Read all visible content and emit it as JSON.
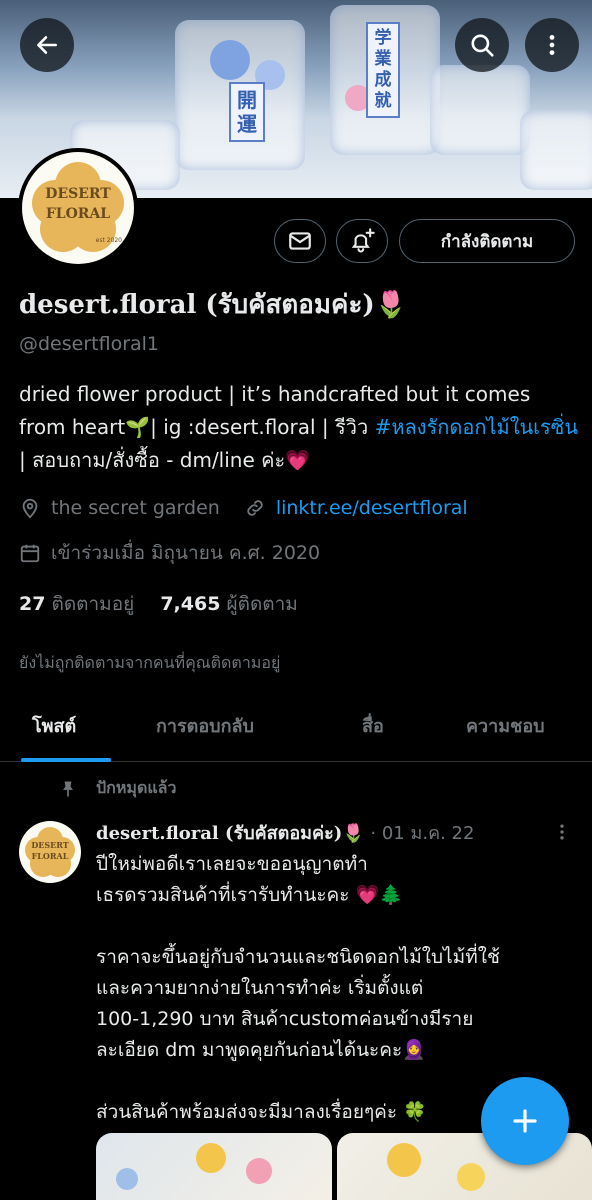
{
  "profile": {
    "name": "desert.floral (รับคัสตอมค่ะ)🌷",
    "handle": "@desertfloral1",
    "bio_part1": "dried flower product | it’s handcrafted but it comes from heart🌱| ig :desert.floral | รีวิว ",
    "bio_hashtag": "#หลงรักดอกไม้ในเรซิ่น",
    "bio_part2": " | สอบถาม/สั่งซื้อ - dm/line ค่ะ💗",
    "location": "the secret garden",
    "website": "linktr.ee/desertfloral",
    "joined": "เข้าร่วมเมื่อ มิถุนายน ค.ศ. 2020",
    "following_count": "27",
    "following_label": "ติดตามอยู่",
    "followers_count": "7,465",
    "followers_label": "ผู้ติดตาม",
    "not_followed_note": "ยังไม่ถูกติดตามจากคนที่คุณติดตามอยู่",
    "avatar_text_line1": "DESERT",
    "avatar_text_line2": "FLORAL",
    "avatar_text_small": "est 2020"
  },
  "banner": {
    "charm1": "開運",
    "charm2": "学業成就"
  },
  "actions": {
    "follow_label": "กำลังติดตาม",
    "back_icon": "arrow-left-icon",
    "search_icon": "search-icon",
    "more_icon": "more-vertical-icon",
    "message_icon": "envelope-icon",
    "notify_icon": "bell-plus-icon"
  },
  "tabs": [
    {
      "label": "โพสต์",
      "active": true
    },
    {
      "label": "การตอบกลับ",
      "active": false
    },
    {
      "label": "สื่อ",
      "active": false
    },
    {
      "label": "ความชอบ",
      "active": false
    }
  ],
  "post": {
    "pinned_label": "ปักหมุดแล้ว",
    "author": "desert.floral (รับคัสตอมค่ะ)🌷",
    "date": " · 01 ม.ค. 22",
    "body": "ปีใหม่พอดีเราเลยจะขออนุญาตทำ\nเธรดรวมสินค้าที่เรารับทำนะคะ 💗🌲\n\nราคาจะขึ้นอยู่กับจำนวนและชนิดดอกไม้ใบไม้ที่ใช้\nและความยากง่ายในการทำค่ะ เริ่มตั้งแต่\n100-1,290 บาท สินค้าcustomค่อนข้างมีราย\nละเอียด dm มาพูดคุยกันก่อนได้นะคะ🧕\n\nส่วนสินค้าพร้อมส่งจะมีมาลงเรื่อยๆค่ะ 🍀"
  },
  "colors": {
    "accent": "#1d9bf0",
    "muted": "#71767b",
    "text": "#e7e9ea",
    "background": "#000000"
  }
}
